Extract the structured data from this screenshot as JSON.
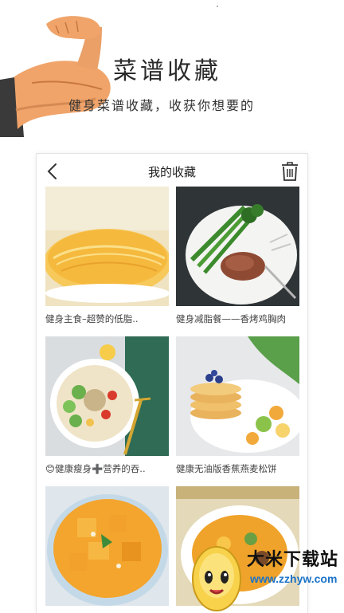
{
  "promo": {
    "title": "菜谱收藏",
    "subtitle": "健身菜谱收藏，收获你想要的"
  },
  "screen": {
    "title": "我的收藏",
    "back_icon": "chevron-left-icon",
    "delete_icon": "trash-icon"
  },
  "recipes": [
    {
      "label": "健身主食–超赞的低脂..",
      "image": "egg-noodle-pancake"
    },
    {
      "label": "健身减脂餐——香烤鸡胸肉",
      "image": "grilled-chicken-asparagus"
    },
    {
      "label": "😊健康瘦身➕营养的吞..",
      "image": "tuna-vegetable-salad"
    },
    {
      "label": "健康无油版香蕉燕麦松饼",
      "image": "banana-oat-pancakes"
    },
    {
      "label": "",
      "image": "mango-bowl"
    },
    {
      "label": "",
      "image": "vegetable-soup"
    }
  ],
  "watermark": {
    "name": "大米下载站",
    "url": "www.zzhyw.com"
  },
  "colors": {
    "accent": "#1a73c8",
    "border": "#e4e4e4"
  }
}
